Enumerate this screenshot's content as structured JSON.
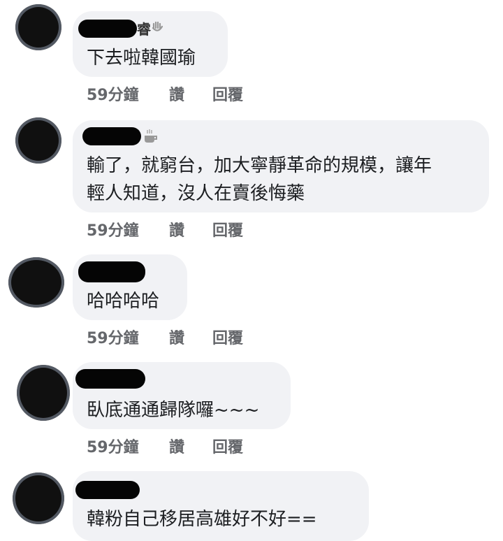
{
  "comments": [
    {
      "name_suffix": "睿",
      "name_icon": "wave-hand-icon",
      "text": "下去啦韓國瑜",
      "time": "59分鐘",
      "like": "讚",
      "reply": "回覆"
    },
    {
      "name_suffix": "",
      "name_icon": "coffee-cup-icon",
      "text_lines": [
        "輸了，就窮台，加大寧靜革命的規模，讓年",
        "輕人知道，沒人在賣後悔藥"
      ],
      "time": "59分鐘",
      "like": "讚",
      "reply": "回覆"
    },
    {
      "name_suffix": "",
      "text": "哈哈哈哈",
      "time": "59分鐘",
      "like": "讚",
      "reply": "回覆"
    },
    {
      "name_suffix": "",
      "text": "臥底通通歸隊囉~~~",
      "time": "59分鐘",
      "like": "讚",
      "reply": "回覆"
    },
    {
      "name_suffix": "",
      "text": "韓粉自己移居高雄好不好==",
      "time": "",
      "like": "",
      "reply": ""
    }
  ]
}
